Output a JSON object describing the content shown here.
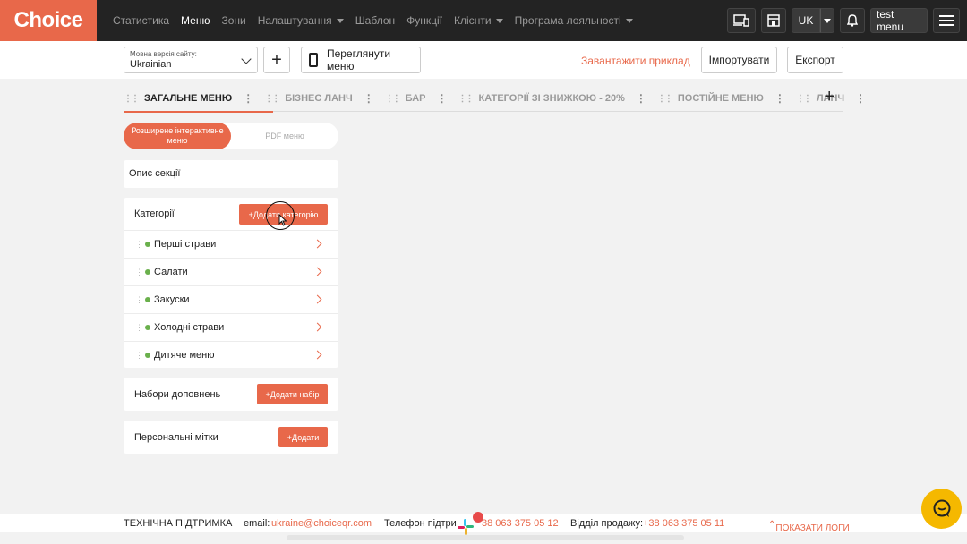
{
  "logo": "Choice",
  "nav": [
    {
      "label": "Статистика",
      "active": false,
      "dropdown": false
    },
    {
      "label": "Меню",
      "active": true,
      "dropdown": false
    },
    {
      "label": "Зони",
      "active": false,
      "dropdown": false
    },
    {
      "label": "Налаштування",
      "active": false,
      "dropdown": true
    },
    {
      "label": "Шаблон",
      "active": false,
      "dropdown": false
    },
    {
      "label": "Функції",
      "active": false,
      "dropdown": false
    },
    {
      "label": "Клієнти",
      "active": false,
      "dropdown": true
    },
    {
      "label": "Програма лояльності",
      "active": false,
      "dropdown": true
    }
  ],
  "topright": {
    "lang": "UK",
    "menu_name": "test menu"
  },
  "toolbar": {
    "lang_label": "Мовна версія сайту:",
    "lang_value": "Ukrainian",
    "view_menu": "Переглянути меню",
    "download_sample": "Завантажити приклад",
    "import": "Імпортувати",
    "export": "Експорт"
  },
  "tabs": [
    "ЗАГАЛЬНЕ МЕНЮ",
    "БІЗНЕС ЛАНЧ",
    "БАР",
    "КАТЕГОРІЇ ЗІ ЗНИЖКОЮ - 20%",
    "ПОСТІЙНЕ МЕНЮ",
    "ЛАНЧ"
  ],
  "mode": {
    "active": "Розширене інтерактивне меню",
    "inactive": "PDF меню"
  },
  "section_desc": "Опис секції",
  "categories": {
    "title": "Категорії",
    "add_btn": "+Додати категорію",
    "items": [
      "Перші страви",
      "Салати",
      "Закуски",
      "Холодні страви",
      "Дитяче меню"
    ]
  },
  "addons": {
    "title": "Набори доповнень",
    "add_btn": "+Додати набір"
  },
  "tags": {
    "title": "Персональні мітки",
    "add_btn": "+Додати"
  },
  "footer": {
    "support": "ТЕХНІЧНА ПІДТРИМКА",
    "email_label": "email:",
    "email": "ukraine@choiceqr.com",
    "phone_label": "Телефон підтри",
    "phone": "38 063 375 05 12",
    "sales_label": "Відділ продажу:",
    "sales": "+38 063 375 05 11",
    "logs": "ПОКАЗАТИ ЛОГИ"
  }
}
